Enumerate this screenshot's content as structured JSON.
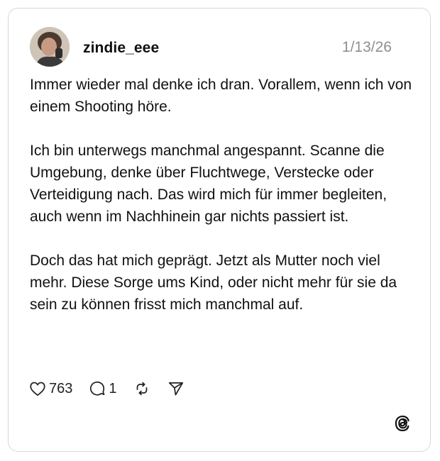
{
  "post": {
    "username": "zindie_eee",
    "date": "1/13/26",
    "paragraphs": [
      "Immer wieder mal denke ich dran. Vorallem, wenn ich von einem Shooting höre.",
      "Ich bin unterwegs manchmal angespannt. Scanne die Umgebung, denke über Fluchtwege, Verstecke oder Verteidigung nach. Das wird mich für immer begleiten, auch wenn im Nachhinein gar nichts passiert ist.",
      "Doch das hat mich geprägt. Jetzt als Mutter noch viel mehr. Diese Sorge ums Kind, oder nicht mehr für sie da sein zu können frisst mich manchmal auf."
    ],
    "likes": "763",
    "replies": "1"
  },
  "icons": {
    "like": "heart-icon",
    "reply": "comment-bubble-icon",
    "repost": "repost-icon",
    "share": "send-icon",
    "brand": "threads-logo-icon"
  },
  "colors": {
    "text": "#101010",
    "muted": "#8f8f8f",
    "border": "#d9d9d9"
  }
}
